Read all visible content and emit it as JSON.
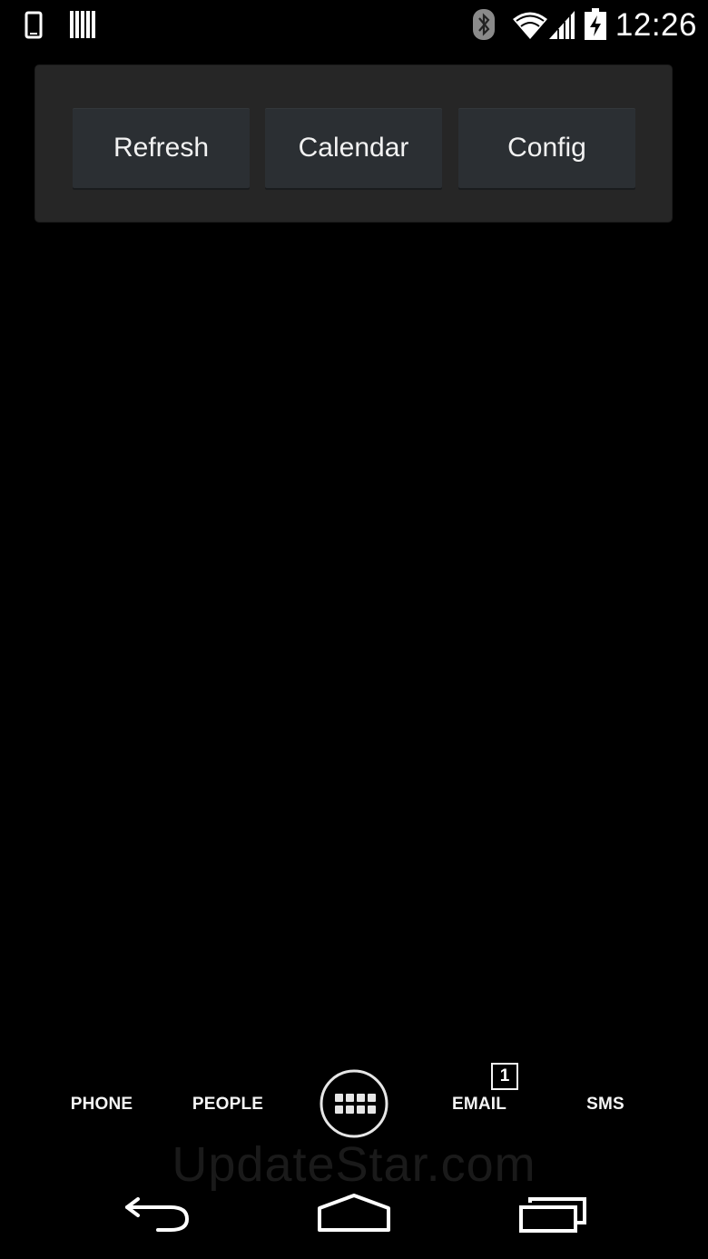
{
  "status_bar": {
    "time": "12:26",
    "icons": [
      "phone-notification-icon",
      "barcode-icon",
      "bluetooth-icon",
      "wifi-icon",
      "cell-signal-icon",
      "battery-charging-icon"
    ]
  },
  "widget": {
    "buttons": [
      {
        "label": "Refresh"
      },
      {
        "label": "Calendar"
      },
      {
        "label": "Config"
      }
    ]
  },
  "dock": {
    "items": [
      {
        "label": "PHONE"
      },
      {
        "label": "PEOPLE"
      },
      {
        "label": "EMAIL",
        "badge": "1"
      },
      {
        "label": "SMS"
      }
    ],
    "apps_icon": "app-drawer-icon"
  },
  "watermark": "UpdateStar.com",
  "nav_bar": {
    "icons": [
      "back-icon",
      "home-icon",
      "recents-icon"
    ]
  },
  "colors": {
    "background": "#000000",
    "widget_bg": "#262626",
    "button_bg": "#2b2f33",
    "text": "#f2f2f2"
  }
}
